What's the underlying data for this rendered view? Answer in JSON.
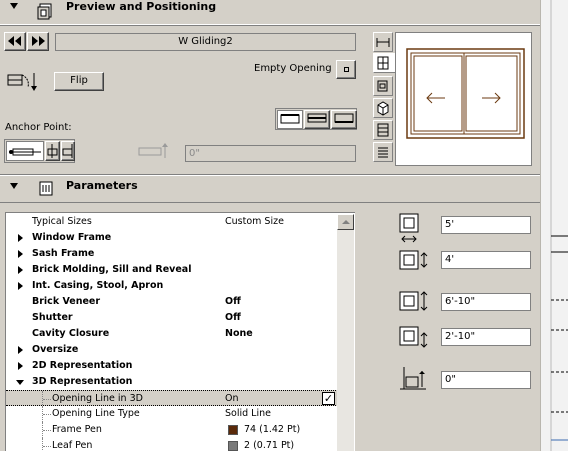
{
  "preview_section": {
    "title": "Preview and Positioning",
    "name_field": "W Gliding2",
    "flip_label": "Flip",
    "empty_opening_label": "Empty Opening",
    "anchor_point_label": "Anchor Point:",
    "offset_value": "0\"",
    "preview_arrows": [
      "←",
      "→"
    ]
  },
  "parameters_section": {
    "title": "Parameters",
    "rows": [
      {
        "name": "Typical Sizes",
        "value": "Custom Size",
        "bold": false,
        "expander": "none"
      },
      {
        "name": "Window Frame",
        "value": "",
        "bold": true,
        "expander": "right"
      },
      {
        "name": "Sash Frame",
        "value": "",
        "bold": true,
        "expander": "right"
      },
      {
        "name": "Brick Molding, Sill and Reveal",
        "value": "",
        "bold": true,
        "expander": "right"
      },
      {
        "name": "Int. Casing, Stool, Apron",
        "value": "",
        "bold": true,
        "expander": "right"
      },
      {
        "name": "Brick Veneer",
        "value": "Off",
        "bold": true,
        "expander": "none"
      },
      {
        "name": "Shutter",
        "value": "Off",
        "bold": true,
        "expander": "none"
      },
      {
        "name": "Cavity Closure",
        "value": "None",
        "bold": true,
        "expander": "none"
      },
      {
        "name": "Oversize",
        "value": "",
        "bold": true,
        "expander": "right"
      },
      {
        "name": "2D Representation",
        "value": "",
        "bold": true,
        "expander": "right"
      },
      {
        "name": "3D Representation",
        "value": "",
        "bold": true,
        "expander": "down"
      },
      {
        "name": "Opening Line in 3D",
        "value": "On",
        "bold": false,
        "expander": "child",
        "selected": true,
        "checked": true
      },
      {
        "name": "Opening Line Type",
        "value": "Solid Line",
        "bold": false,
        "expander": "child"
      },
      {
        "name": "Frame Pen",
        "value": "74 (1.42 Pt)",
        "bold": false,
        "expander": "child",
        "swatch": "#5a2a0a"
      },
      {
        "name": "Leaf Pen",
        "value": "2 (0.71 Pt)",
        "bold": false,
        "expander": "child",
        "swatch": "#7a7a7a"
      }
    ],
    "dimensions": [
      "5'",
      "4'",
      "6'-10\"",
      "2'-10\"",
      "0\""
    ]
  },
  "colors": {
    "panel": "#d4d0c8",
    "frame_brown": "#6b3a10"
  }
}
